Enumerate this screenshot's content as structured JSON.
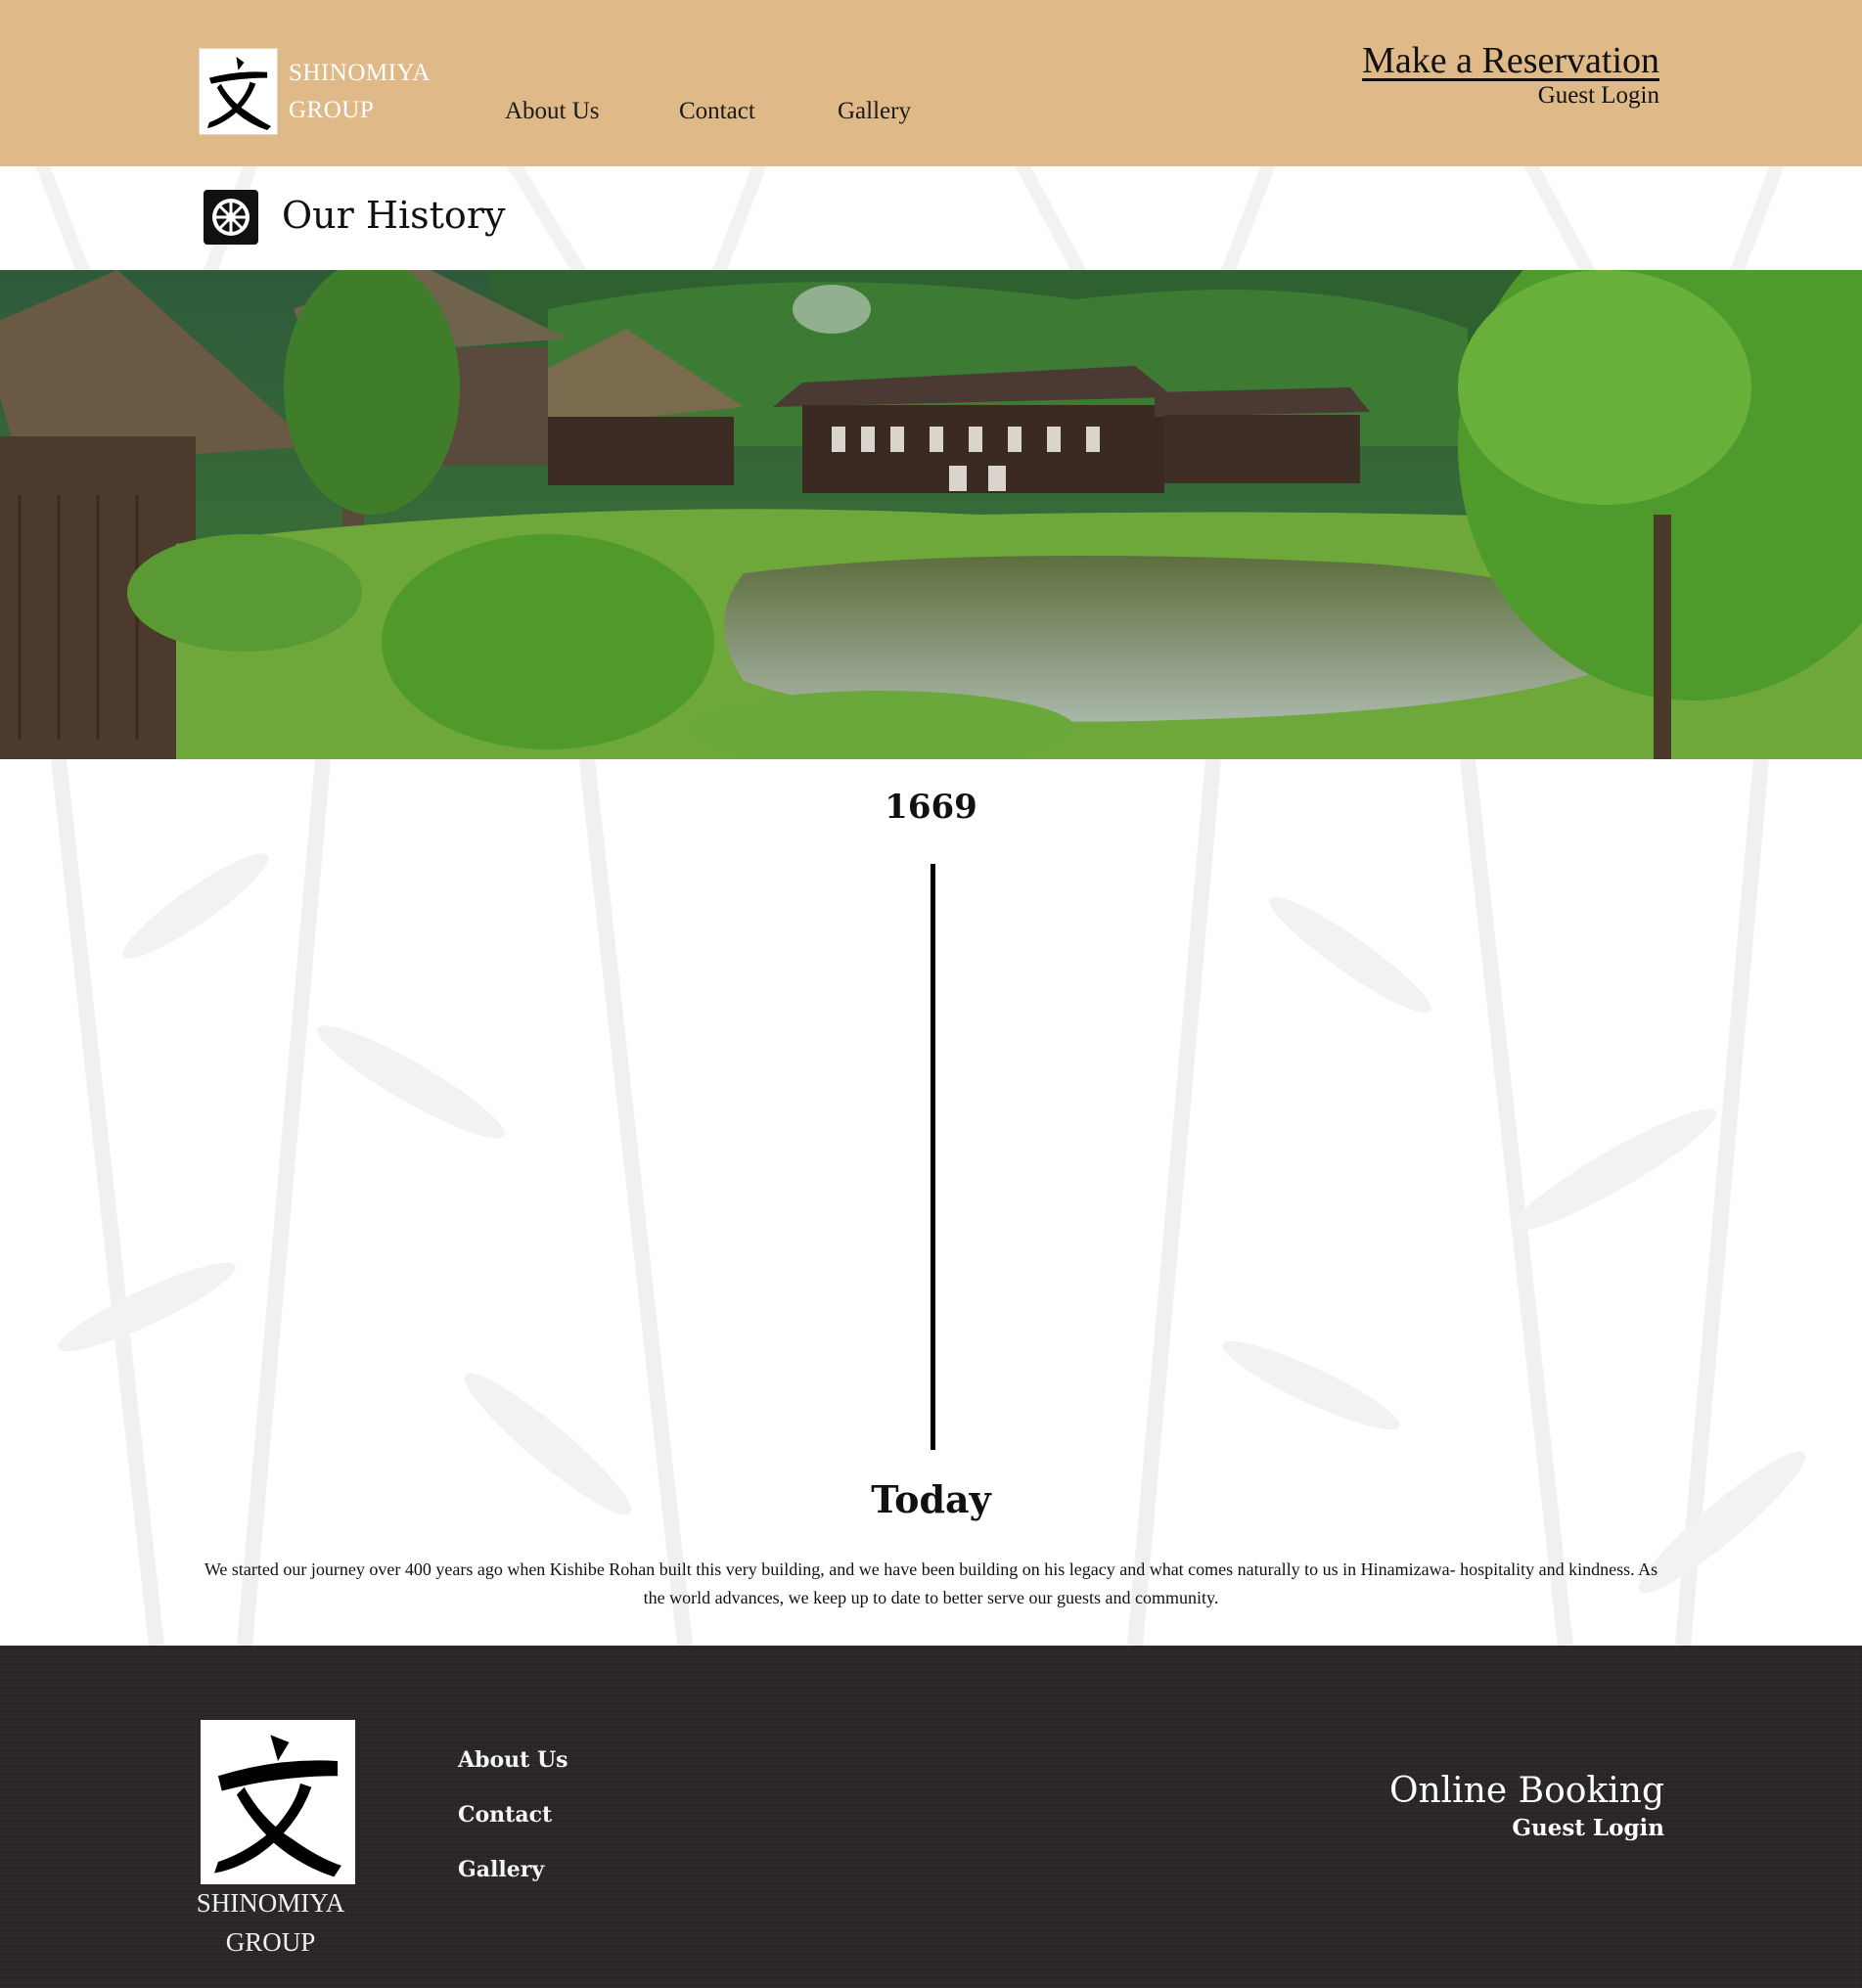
{
  "header": {
    "brand_line1": "SHINOMIYA",
    "brand_line2": "GROUP",
    "nav": [
      "About Us",
      "Contact",
      "Gallery"
    ],
    "reservation_label": "Make a Reservation",
    "guest_login_label": "Guest Login",
    "background_color": "#dfb988"
  },
  "page": {
    "title": "Our History"
  },
  "timeline": {
    "start_year": "1669",
    "end_label": "Today",
    "description": "We started our journey over 400 years ago when Kishibe Rohan built this very building, and we have been building on his legacy and what comes naturally to us in Hinamizawa- hospitality and kindness. As the world advances, we keep up to date to better serve our guests and community."
  },
  "footer": {
    "brand_line1": "SHINOMIYA",
    "brand_line2": "GROUP",
    "links": [
      "About Us",
      "Contact",
      "Gallery"
    ],
    "booking_label": "Online Booking",
    "guest_login_label": "Guest Login",
    "background_color": "#282524"
  }
}
